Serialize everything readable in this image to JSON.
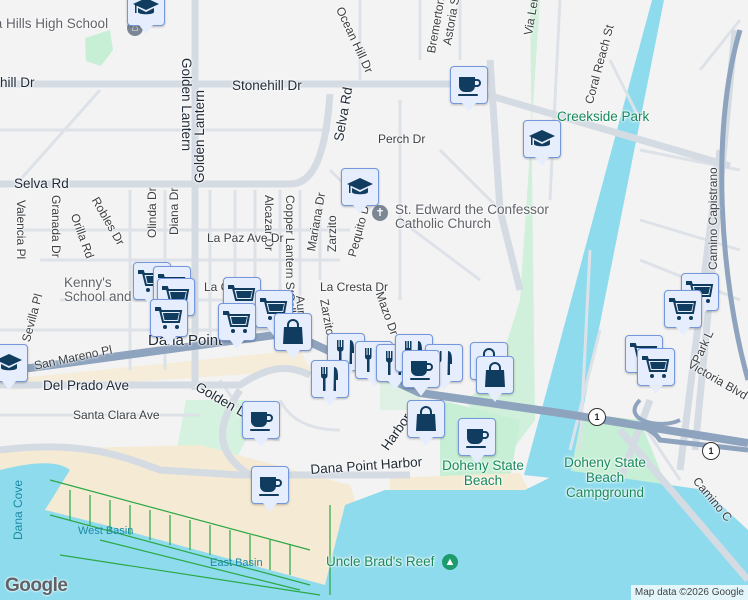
{
  "streets": {
    "stonehill_left": "hill Dr",
    "stonehill": "Stonehill Dr",
    "selva_rd": "Selva Rd",
    "selva_rd_vertical": "Selva Rd",
    "golden_lantern_top": "Golden Lantern",
    "golden_lantern": "Golden Lantern",
    "ocean_hill": "Ocean Hill Dr",
    "perch": "Perch Dr",
    "bremerton": "Bremerton",
    "astoria": "Astoria St",
    "via_lena": "Via Lena",
    "coral_reach": "Coral Reach St",
    "camino_capistrano": "Camino Capistrano",
    "valencia": "Valencia Pl",
    "granada": "Granada Dr",
    "orilla": "Orilla Rd",
    "robles": "Robles Dr",
    "olinda": "Olinda Dr",
    "diana": "Diana Dr",
    "alcazar": "Alcazar Dr",
    "copper_lantern": "Copper Lantern St",
    "mariana": "Mariana Dr",
    "zarzito": "Zarzito",
    "zarzito2": "Zarzito",
    "pequito": "Pequito Dr",
    "la_paz": "La Paz Ave Dr",
    "la_cresta": "La Cresta Dr",
    "la_cresta_left": "La C",
    "mazo": "Mazo Dr",
    "aurelio": "Aurelio",
    "calle": "Calle",
    "san_mareno": "San Mareno Pl",
    "del_prado": "Del Prado Ave",
    "santa_clara": "Santa Clara Ave",
    "golden_lantern_lower": "Golden L",
    "dana_point_harbor": "Dana Point Harbor",
    "victoria": "Victoria Blvd",
    "park_lantern": "Park L",
    "camino_c": "Camino C",
    "sevilla": "Sevilla Pl",
    "harbor_short": "Harbor"
  },
  "places": {
    "high_school": "Dana Hills High School",
    "church": "St. Edward the Confessor Catholic Church",
    "creekside_park": "Creekside Park",
    "dana_point": "Dana Point",
    "kennys": "Kenny's School and",
    "doheny": "Doheny State Beach",
    "doheny_camp": "Doheny State Beach Campground",
    "uncle_brads": "Uncle Brad's Reef",
    "dana_cove": "Dana Cove",
    "west_basin": "West Basin",
    "east_basin": "East Basin"
  },
  "route_shield": "1",
  "markers": [
    {
      "type": "school"
    },
    {
      "type": "cafe"
    },
    {
      "type": "school"
    },
    {
      "type": "school"
    },
    {
      "type": "grocery"
    },
    {
      "type": "grocery"
    },
    {
      "type": "grocery"
    },
    {
      "type": "grocery"
    },
    {
      "type": "grocery"
    },
    {
      "type": "grocery"
    },
    {
      "type": "grocery"
    },
    {
      "type": "shopping"
    },
    {
      "type": "school"
    },
    {
      "type": "restaurant"
    },
    {
      "type": "restaurant"
    },
    {
      "type": "restaurant"
    },
    {
      "type": "restaurant"
    },
    {
      "type": "restaurant"
    },
    {
      "type": "restaurant"
    },
    {
      "type": "cafe"
    },
    {
      "type": "shopping"
    },
    {
      "type": "shopping"
    },
    {
      "type": "cafe"
    },
    {
      "type": "shopping"
    },
    {
      "type": "cafe"
    },
    {
      "type": "cafe"
    },
    {
      "type": "grocery"
    },
    {
      "type": "grocery"
    },
    {
      "type": "grocery"
    },
    {
      "type": "grocery"
    }
  ],
  "attribution": "Map data ©2026 Google",
  "logo": "Google",
  "colors": {
    "water": "#8fdbee",
    "park": "#c7efd5",
    "sand": "#f5ead3",
    "highway": "#8ea3bd",
    "road": "#d4dbe3",
    "marker_icon": "#0f3c5f"
  }
}
